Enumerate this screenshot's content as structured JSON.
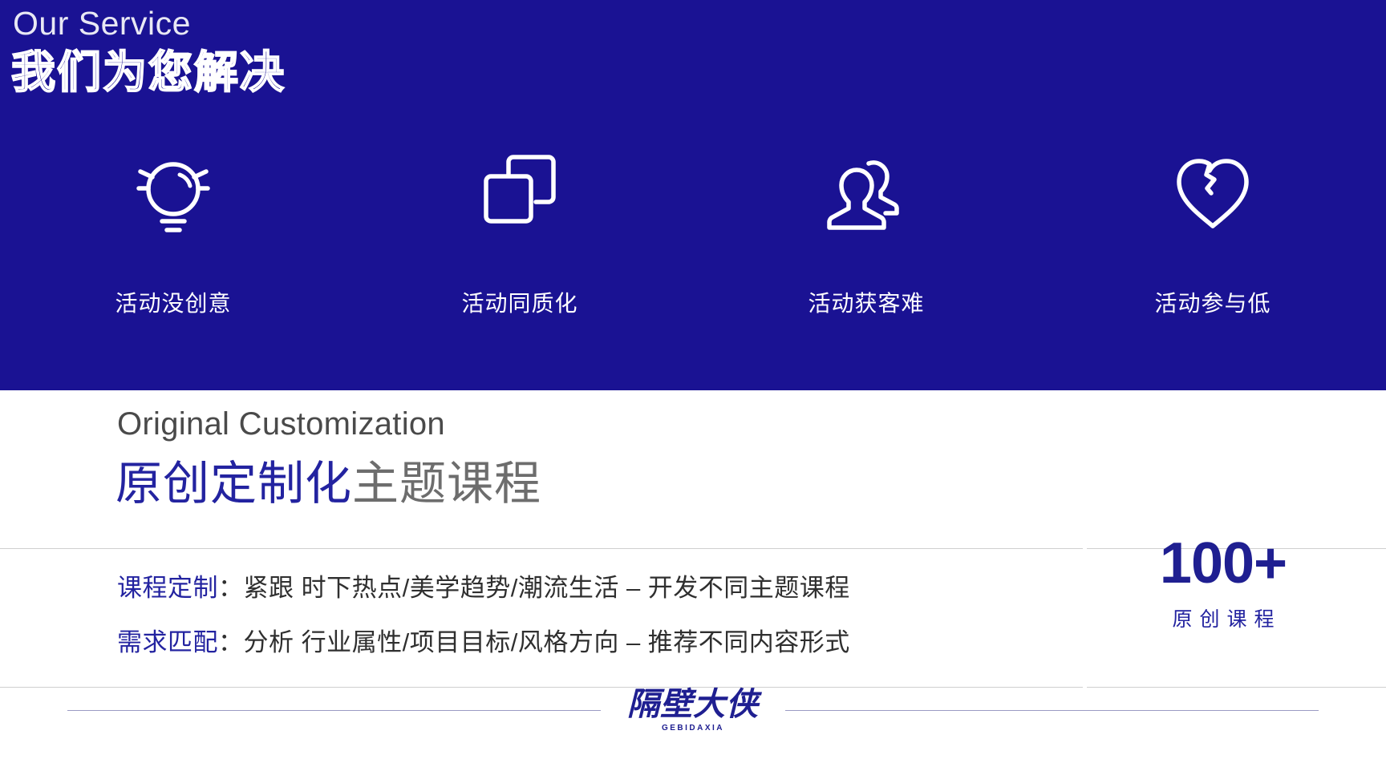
{
  "theme": {
    "brand_blue": "#1a1293",
    "accent_blue": "#2323a0",
    "muted_gray": "#6d6d6d",
    "white": "#ffffff"
  },
  "hero": {
    "eyebrow": "Our Service",
    "title": "我们为您解决",
    "items": [
      {
        "icon": "lightbulb-icon",
        "label": "活动没创意"
      },
      {
        "icon": "overlapping-squares-icon",
        "label": "活动同质化"
      },
      {
        "icon": "two-users-icon",
        "label": "活动获客难"
      },
      {
        "icon": "broken-heart-icon",
        "label": "活动参与低"
      }
    ]
  },
  "section": {
    "subtitle_en": "Original Customization",
    "headline_accent": "原创定制化",
    "headline_muted": "主题课程",
    "bullets": [
      {
        "tag": "课程定制",
        "text": "：紧跟  时下热点/美学趋势/潮流生活  –  开发不同主题课程"
      },
      {
        "tag": "需求匹配",
        "text": "：分析  行业属性/项目目标/风格方向  –  推荐不同内容形式"
      }
    ],
    "stat": {
      "number": "100+",
      "caption": "原创课程"
    }
  },
  "footer": {
    "logo_mark": "隔壁大侠",
    "logo_sub": "GEBIDAXIA"
  }
}
